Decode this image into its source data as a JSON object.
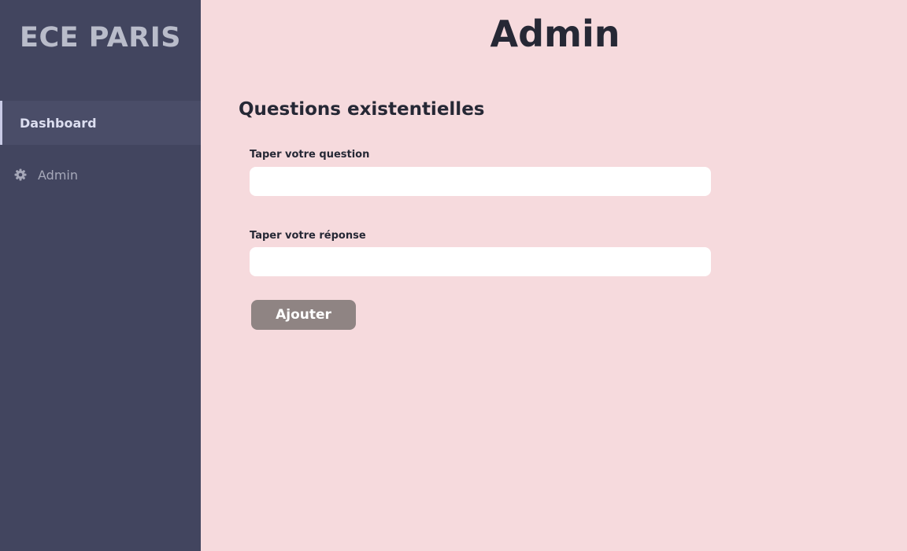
{
  "sidebar": {
    "brand": "ECE PARIS",
    "items": [
      {
        "label": "Dashboard",
        "active": true,
        "icon": "none"
      },
      {
        "label": "Admin",
        "active": false,
        "icon": "gear-icon"
      }
    ]
  },
  "main": {
    "title": "Admin",
    "section_title": "Questions existentielles",
    "question_label": "Taper votre question",
    "question_value": "",
    "answer_label": "Taper votre réponse",
    "answer_value": "",
    "add_button_label": "Ajouter"
  },
  "colors": {
    "sidebar_bg": "#42455f",
    "main_bg": "#f6dadd",
    "button_bg": "#8f8483",
    "text_dark": "#262835"
  }
}
